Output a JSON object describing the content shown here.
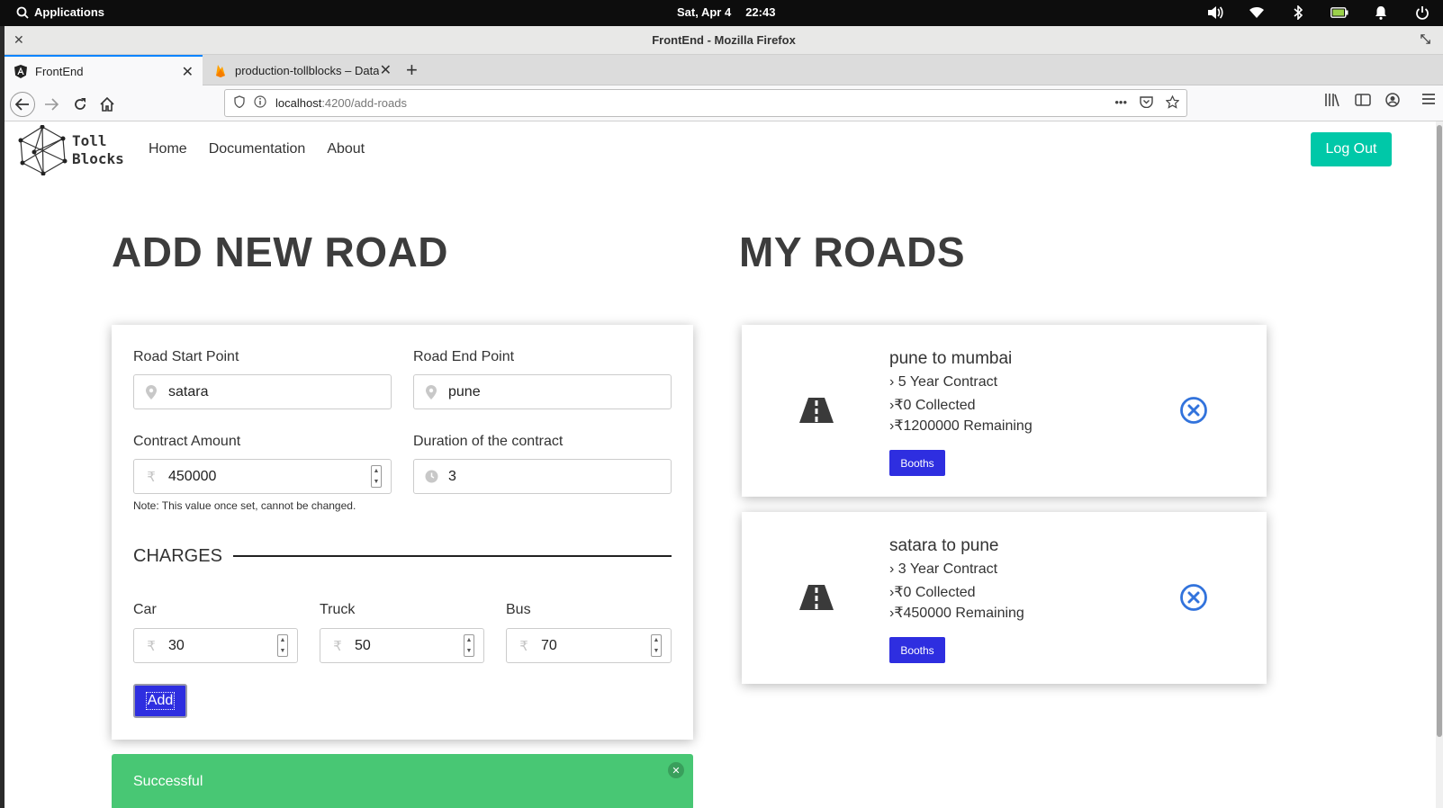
{
  "system": {
    "applications": "Applications",
    "date": "Sat, Apr 4",
    "time": "22:43"
  },
  "window": {
    "title": "FrontEnd - Mozilla Firefox",
    "tabs": [
      {
        "label": "FrontEnd",
        "icon": "angular-icon"
      },
      {
        "label": "production-tollblocks – Datab",
        "icon": "firebase-icon"
      }
    ],
    "url": {
      "host": "localhost",
      "path": ":4200/add-roads"
    }
  },
  "app": {
    "logo": {
      "line1": "Toll",
      "line2": "Blocks"
    },
    "nav": [
      "Home",
      "Documentation",
      "About"
    ],
    "logout": "Log Out",
    "add_heading": "ADD NEW ROAD",
    "my_roads_heading": "MY ROADS",
    "form": {
      "start_label": "Road Start Point",
      "start_value": "satara",
      "end_label": "Road End Point",
      "end_value": "pune",
      "amount_label": "Contract Amount",
      "amount_value": "450000",
      "duration_label": "Duration of the contract",
      "duration_value": "3",
      "note": "Note: This value once set, cannot be changed.",
      "charges_heading": "CHARGES",
      "car_label": "Car",
      "car_value": "30",
      "truck_label": "Truck",
      "truck_value": "50",
      "bus_label": "Bus",
      "bus_value": "70",
      "add_button": "Add"
    },
    "toast": "Successful",
    "roads": [
      {
        "title": "pune to mumbai",
        "contract": "5 Year Contract",
        "collected": "₹0 Collected",
        "remaining": "₹1200000 Remaining",
        "button": "Booths"
      },
      {
        "title": "satara to pune",
        "contract": "3 Year Contract",
        "collected": "₹0 Collected",
        "remaining": "₹450000 Remaining",
        "button": "Booths"
      }
    ]
  },
  "colors": {
    "accent_teal": "#00c8a8",
    "button_blue": "#2e2ee0",
    "success_green": "#48c774",
    "delete_blue": "#3273dc"
  }
}
